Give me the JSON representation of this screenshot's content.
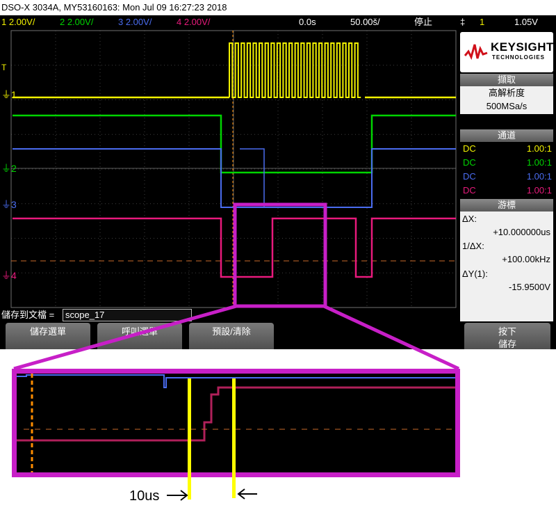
{
  "title_bar": "DSO-X 3034A, MY53160163: Mon Jul 09 16:27:23 2018",
  "status": {
    "ch1": "1  2.00V/",
    "ch2": "2  2.00V/",
    "ch3": "3  2.00V/",
    "ch4": "4  2.00V/",
    "time_offset": "0.0s",
    "time_scale": "50.00š/",
    "run_state": "停止",
    "trigger_symbol": "‡",
    "trigger_channel": "1",
    "trigger_level": "1.05V"
  },
  "logo": {
    "line1": "KEYSIGHT",
    "line2": "TECHNOLOGIES"
  },
  "acquire": {
    "header": "擷取",
    "mode": "高解析度",
    "rate": "500MSa/s"
  },
  "channels": {
    "header": "通道",
    "rows": [
      {
        "coupling": "DC",
        "ratio": "1.00:1",
        "color": "#f2f200"
      },
      {
        "coupling": "DC",
        "ratio": "1.00:1",
        "color": "#00d400"
      },
      {
        "coupling": "DC",
        "ratio": "1.00:1",
        "color": "#4a6cf0"
      },
      {
        "coupling": "DC",
        "ratio": "1.00:1",
        "color": "#e81a7c"
      }
    ]
  },
  "cursors": {
    "header": "游標",
    "dx_label": "ΔX:",
    "dx_value": "+10.000000us",
    "inv_dx_label": "1/ΔX:",
    "inv_dx_value": "+100.00kHz",
    "dy_label": "ΔY(1):",
    "dy_value": "-15.9500V"
  },
  "save_bar": {
    "label": "儲存到文檔 =",
    "filename": "scope_17"
  },
  "softkeys": [
    {
      "label": "儲存選單"
    },
    {
      "label": "呼叫選單"
    },
    {
      "label": "預設/清除"
    },
    {
      "label_line1": "按下",
      "label_line2": "儲存"
    }
  ],
  "channel_markers": [
    "1",
    "2",
    "3",
    "4"
  ],
  "trigger_marker": "T",
  "annotation": {
    "text": "10us"
  },
  "colors": {
    "ch1": "#f2f200",
    "ch2": "#00d400",
    "ch3": "#4a6cf0",
    "ch4": "#e81a7c",
    "zoom_box": "#c71fc7",
    "trigger_marker": "#ff8c00"
  }
}
